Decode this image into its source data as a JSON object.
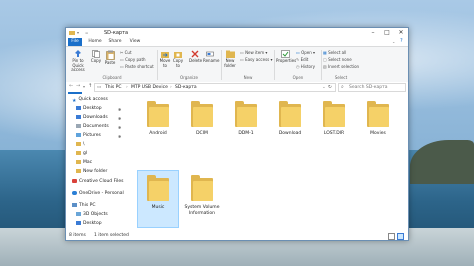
{
  "window": {
    "title": "SD-карта",
    "controls": {
      "minimize": "–",
      "maximize": "□",
      "close": "✕"
    }
  },
  "ribbon": {
    "tabs": [
      "File",
      "Home",
      "Share",
      "View"
    ],
    "clipboard": {
      "group": "Clipboard",
      "pin_quick_access": "Pin to Quick access",
      "copy": "Copy",
      "paste": "Paste",
      "cut": "Cut",
      "copy_path": "Copy path",
      "paste_shortcut": "Paste shortcut"
    },
    "organize": {
      "group": "Organize",
      "move_to": "Move to",
      "copy_to": "Copy to",
      "delete": "Delete",
      "rename": "Rename"
    },
    "new": {
      "group": "New",
      "new_folder": "New folder",
      "new_item": "New item",
      "easy_access": "Easy access"
    },
    "open": {
      "group": "Open",
      "properties": "Properties",
      "open": "Open",
      "edit": "Edit",
      "history": "History"
    },
    "select": {
      "group": "Select",
      "select_all": "Select all",
      "select_none": "Select none",
      "invert_selection": "Invert selection"
    }
  },
  "address": {
    "crumbs": [
      "This PC",
      "MTP USB Device",
      "SD-карта"
    ],
    "search_placeholder": "Search SD-карта"
  },
  "sidebar": {
    "items": [
      {
        "label": "Quick access",
        "icon": "star-icon"
      },
      {
        "label": "Desktop",
        "icon": "desktop-icon"
      },
      {
        "label": "Downloads",
        "icon": "download-icon"
      },
      {
        "label": "Documents",
        "icon": "documents-icon"
      },
      {
        "label": "Pictures",
        "icon": "pictures-icon"
      },
      {
        "label": "\\",
        "icon": "folder-icon"
      },
      {
        "label": "gl",
        "icon": "folder-icon"
      },
      {
        "label": "Mac",
        "icon": "folder-icon"
      },
      {
        "label": "New folder",
        "icon": "folder-icon"
      },
      {
        "label": "Creative Cloud Files",
        "icon": "creative-cloud-icon"
      },
      {
        "label": "OneDrive - Personal",
        "icon": "onedrive-icon"
      },
      {
        "label": "This PC",
        "icon": "computer-icon"
      },
      {
        "label": "3D Objects",
        "icon": "cube-icon"
      },
      {
        "label": "Desktop",
        "icon": "desktop-icon"
      }
    ]
  },
  "files": [
    {
      "name": "Android"
    },
    {
      "name": "DCIM"
    },
    {
      "name": "DDM-1"
    },
    {
      "name": "Download"
    },
    {
      "name": "LOST.DIR"
    },
    {
      "name": "Movies"
    },
    {
      "name": "Music",
      "selected": true
    },
    {
      "name": "System Volume Information"
    }
  ],
  "status": {
    "count": "8 items",
    "selected": "1 item selected"
  },
  "colors": {
    "accent": "#1a6fc9",
    "folder": "#f5d168",
    "selection": "#cce8ff"
  }
}
